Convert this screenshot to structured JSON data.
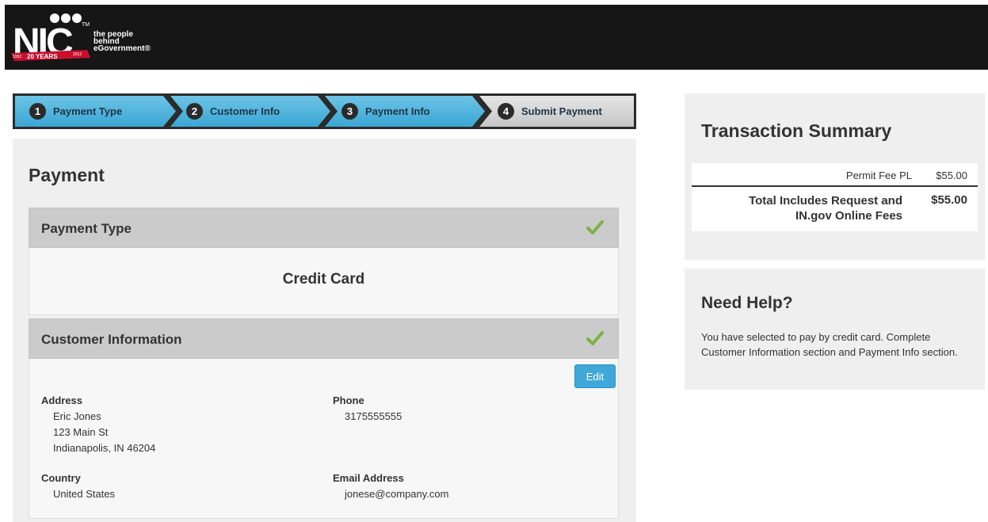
{
  "header": {
    "logo_text": "NIC",
    "logo_banner": "20 YEARS",
    "logo_year_start": "1992",
    "logo_year_end": "2012",
    "trademark": "TM",
    "tagline_line1": "the people",
    "tagline_line2": "behind",
    "tagline_line3": "eGovernment®"
  },
  "steps": [
    {
      "number": "1",
      "label": "Payment Type"
    },
    {
      "number": "2",
      "label": "Customer Info"
    },
    {
      "number": "3",
      "label": "Payment Info"
    },
    {
      "number": "4",
      "label": "Submit Payment"
    }
  ],
  "main": {
    "title": "Payment",
    "payment_type": {
      "heading": "Payment Type",
      "value": "Credit Card"
    },
    "customer": {
      "heading": "Customer Information",
      "edit_label": "Edit",
      "address_label": "Address",
      "address_name": "Eric Jones",
      "address_street": "123 Main St",
      "address_city": "Indianapolis, IN 46204",
      "phone_label": "Phone",
      "phone_value": "3175555555",
      "country_label": "Country",
      "country_value": "United States",
      "email_label": "Email Address",
      "email_value": "jonese@company.com"
    }
  },
  "summary": {
    "title": "Transaction Summary",
    "fee_name": "Permit Fee PL",
    "fee_amount": "$55.00",
    "total_label_line1": "Total Includes Request and",
    "total_label_line2": "IN.gov Online Fees",
    "total_amount": "$55.00"
  },
  "help": {
    "title": "Need Help?",
    "text": "You have selected to pay by credit card. Complete Customer Information section and Payment Info section."
  },
  "colors": {
    "header_bg": "#161616",
    "step_active": "#4ab2da",
    "step_inactive": "#d6d6d6",
    "panel_bg": "#efefef",
    "section_head_bg": "#cbcbcb",
    "check_green": "#7ab342",
    "edit_button": "#3fa8d8"
  }
}
